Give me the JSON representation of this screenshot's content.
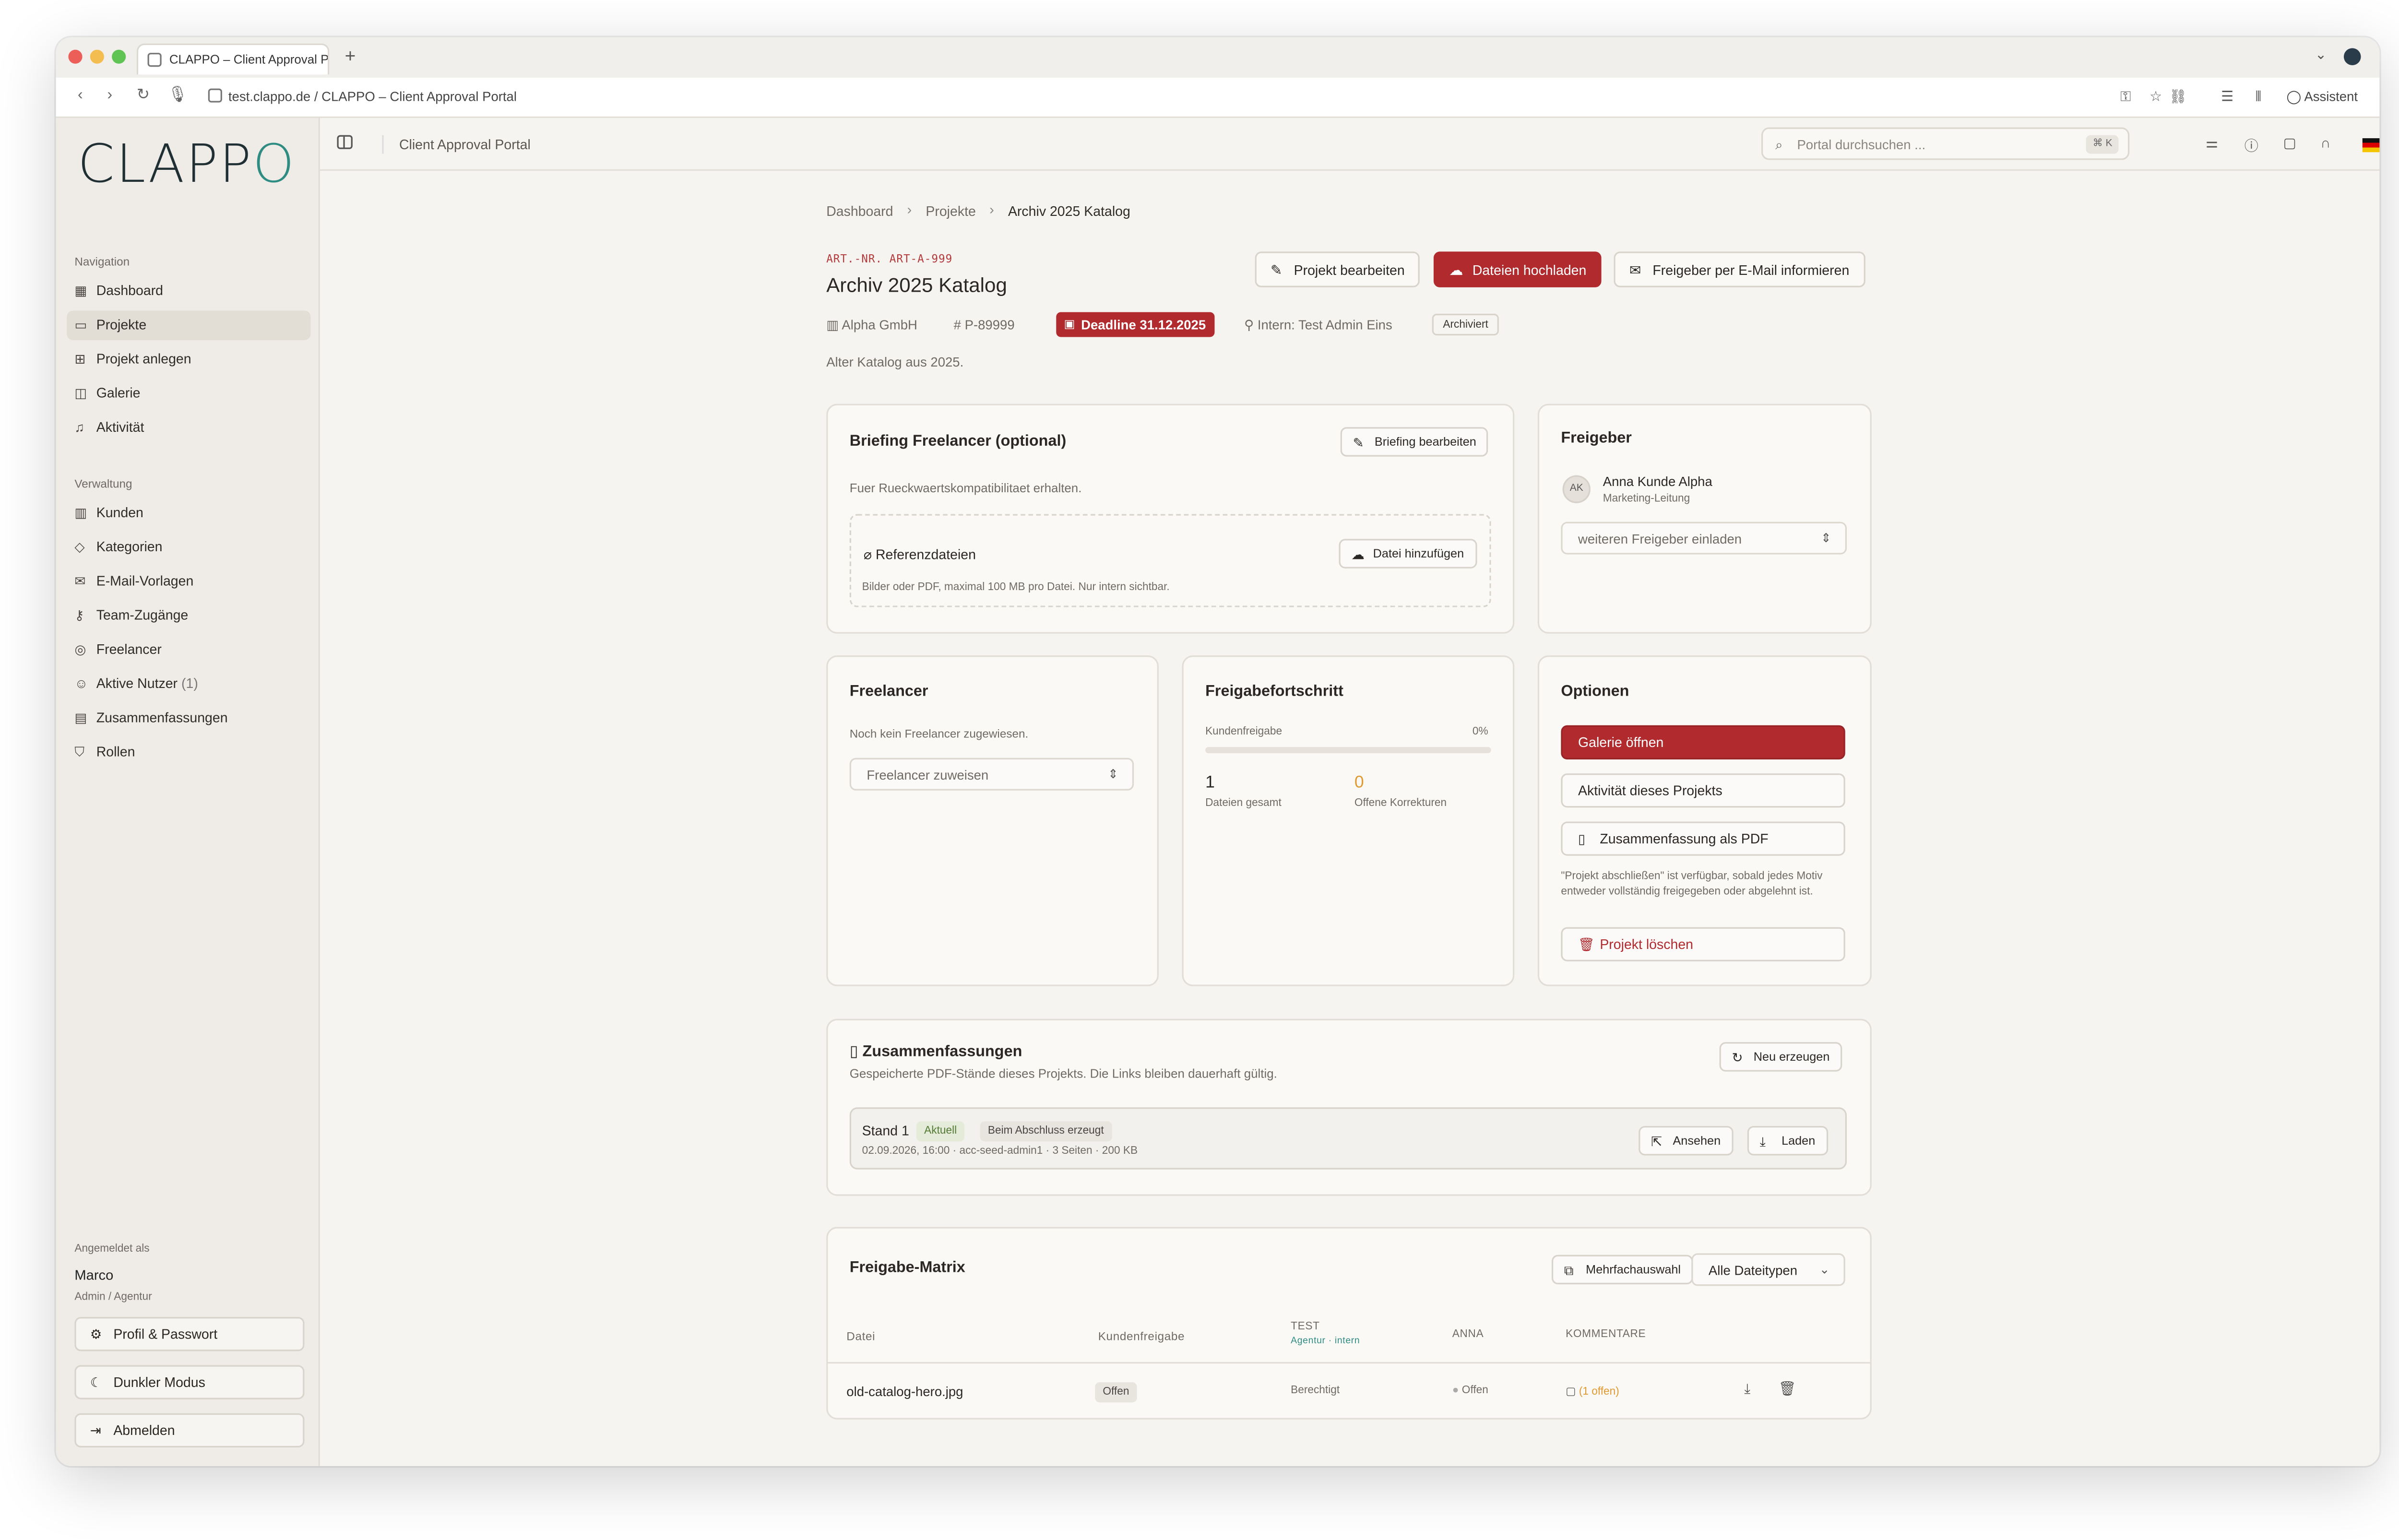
{
  "browser": {
    "tab_title": "CLAPPO – Client Approval P",
    "url": "test.clappo.de / CLAPPO – Client Approval Portal",
    "assistant_label": "Assistent"
  },
  "sidebar": {
    "logo": "CLAPP",
    "logo_o": "O",
    "nav_heading": "Navigation",
    "nav": [
      {
        "label": "Dashboard"
      },
      {
        "label": "Projekte"
      },
      {
        "label": "Projekt anlegen"
      },
      {
        "label": "Galerie"
      },
      {
        "label": "Aktivität"
      }
    ],
    "admin_heading": "Verwaltung",
    "admin": [
      {
        "label": "Kunden"
      },
      {
        "label": "Kategorien"
      },
      {
        "label": "E-Mail-Vorlagen"
      },
      {
        "label": "Team-Zugänge"
      },
      {
        "label": "Freelancer"
      },
      {
        "label": "Aktive Nutzer",
        "count": "(1)"
      },
      {
        "label": "Zusammenfassungen"
      },
      {
        "label": "Rollen"
      }
    ],
    "logged_in_label": "Angemeldet als",
    "user_name": "Marco",
    "user_role": "Admin / Agentur",
    "profile_button": "Profil & Passwort",
    "dark_mode_button": "Dunkler Modus",
    "logout_button": "Abmelden"
  },
  "topbar": {
    "title": "Client Approval Portal",
    "search_placeholder": "Portal durchsuchen ...",
    "search_kbd": "⌘ K"
  },
  "breadcrumb": {
    "items": [
      "Dashboard",
      "Projekte",
      "Archiv 2025 Katalog"
    ]
  },
  "project": {
    "art_no": "ART.-NR. ART-A-999",
    "title": "Archiv 2025 Katalog",
    "edit_button": "Projekt bearbeiten",
    "upload_button": "Dateien hochladen",
    "notify_button": "Freigeber per E-Mail informieren",
    "client": "Alpha GmbH",
    "number": "P-89999",
    "deadline": "Deadline 31.12.2025",
    "internal": "Intern: Test Admin Eins",
    "status": "Archiviert",
    "description": "Alter Katalog aus 2025."
  },
  "briefing": {
    "title": "Briefing Freelancer (optional)",
    "edit_button": "Briefing bearbeiten",
    "text": "Fuer Rueckwaertskompatibilitaet erhalten.",
    "ref_title": "Referenzdateien",
    "add_file_button": "Datei hinzufügen",
    "ref_hint": "Bilder oder PDF, maximal 100 MB pro Datei. Nur intern sichtbar."
  },
  "approvers": {
    "title": "Freigeber",
    "avatar": "AK",
    "name": "Anna Kunde Alpha",
    "role": "Marketing-Leitung",
    "invite_placeholder": "weiteren Freigeber einladen"
  },
  "freelancer": {
    "title": "Freelancer",
    "empty_text": "Noch kein Freelancer zugewiesen.",
    "assign_placeholder": "Freelancer zuweisen"
  },
  "progress": {
    "title": "Freigabefortschritt",
    "label": "Kundenfreigabe",
    "percent_label": "0%",
    "percent": 0,
    "files_total": "1",
    "files_total_label": "Dateien gesamt",
    "open_corrections": "0",
    "open_corrections_label": "Offene Korrekturen"
  },
  "options": {
    "title": "Optionen",
    "gallery_button": "Galerie öffnen",
    "activity_button": "Aktivität dieses Projekts",
    "summary_pdf_button": "Zusammenfassung als PDF",
    "hint": "\"Projekt abschließen\" ist verfügbar, sobald jedes Motiv entweder vollständig freigegeben oder abgelehnt ist.",
    "delete_button": "Projekt löschen"
  },
  "summaries": {
    "title": "Zusammenfassungen",
    "subtitle": "Gespeicherte PDF-Stände dieses Projekts. Die Links bleiben dauerhaft gültig.",
    "regenerate_button": "Neu erzeugen",
    "items": [
      {
        "name": "Stand 1",
        "badge_current": "Aktuell",
        "badge_origin": "Beim Abschluss erzeugt",
        "meta": "02.09.2026, 16:00 · acc-seed-admin1 · 3 Seiten · 200 KB",
        "view_button": "Ansehen",
        "download_button": "Laden"
      }
    ]
  },
  "matrix": {
    "title": "Freigabe-Matrix",
    "multi_select_button": "Mehrfachauswahl",
    "filesel_value": "Alle Dateitypen",
    "columns": {
      "file": "Datei",
      "client_approval": "Kundenfreigabe",
      "test": "TEST",
      "test_sub": "Agentur · intern",
      "anna": "ANNA",
      "comments": "KOMMENTARE"
    },
    "rows": [
      {
        "file": "old-catalog-hero.jpg",
        "client_status": "Offen",
        "test_status": "Berechtigt",
        "anna_status": "Offen",
        "comments": "(1 offen)"
      }
    ]
  },
  "colors": {
    "accent": "#b02a2e",
    "logo_o": "#2f8c82",
    "warning": "#e09a32"
  }
}
